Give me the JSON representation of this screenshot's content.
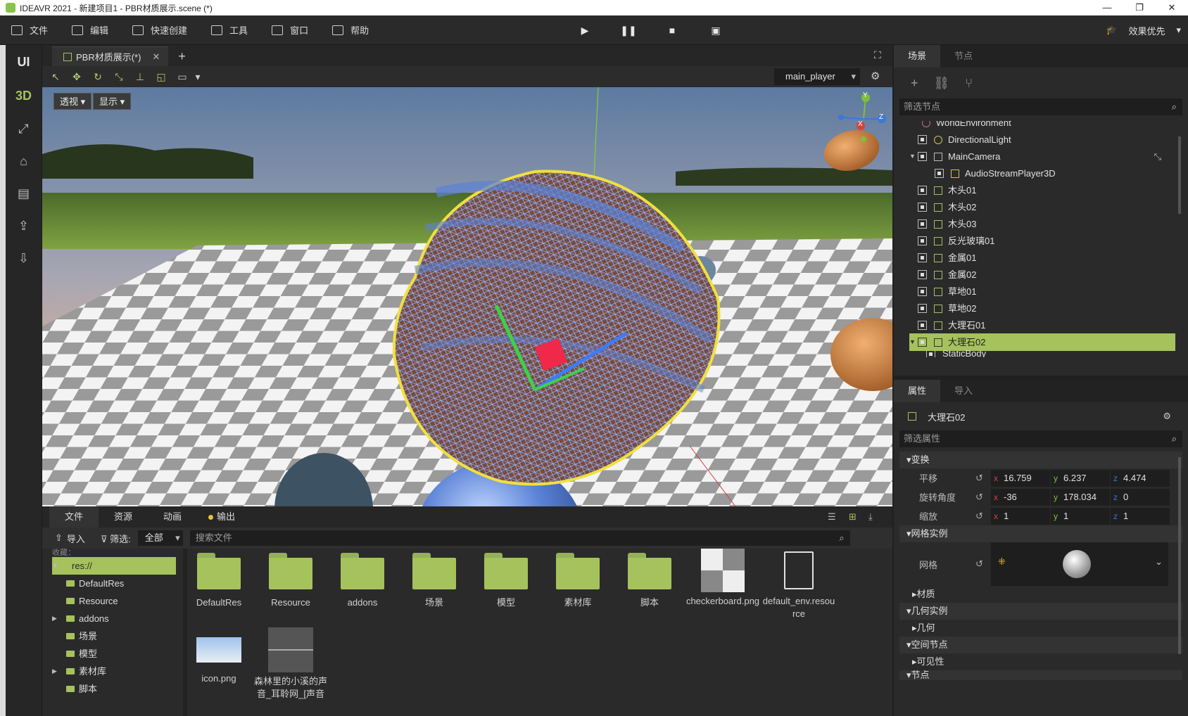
{
  "window": {
    "title": "IDEAVR 2021 - 新建项目1 - PBR材质展示.scene (*)",
    "controls": [
      "—",
      "❐",
      "✕"
    ]
  },
  "menu": {
    "items": [
      "文件",
      "编辑",
      "快速创建",
      "工具",
      "窗口",
      "帮助"
    ],
    "quality": "效果优先"
  },
  "leftbar": {
    "ui": "UI",
    "three_d": "3D"
  },
  "editor": {
    "tab_label": "PBR材质展示(*)",
    "player": "main_player",
    "grid_label": "网格",
    "view_mode": "透视",
    "display_mode": "显示",
    "gizmo_axes": [
      "Y",
      "Z",
      "X"
    ]
  },
  "bottom": {
    "tabs": [
      "文件",
      "资源",
      "动画",
      "输出"
    ],
    "import_label": "导入",
    "filter_label": "筛选:",
    "filter_value": "全部",
    "search_placeholder": "搜索文件",
    "tree_favorites": "收藏：",
    "tree": [
      "res://",
      "DefaultRes",
      "Resource",
      "addons",
      "场景",
      "模型",
      "素材库",
      "脚本"
    ],
    "files_row1": [
      "DefaultRes",
      "Resource",
      "addons",
      "场景",
      "模型",
      "素材库",
      "脚本",
      "checkerboard.png",
      "default_env.resource"
    ],
    "files_row2": [
      "icon.png",
      "森林里的小溪的声音_耳聆网_[声音"
    ]
  },
  "scene": {
    "tabs": [
      "场景",
      "节点"
    ],
    "filter_placeholder": "筛选节点",
    "nodes": [
      "WorldEnvironment",
      "DirectionalLight",
      "MainCamera",
      "AudioStreamPlayer3D",
      "木头01",
      "木头02",
      "木头03",
      "反光玻璃01",
      "金属01",
      "金属02",
      "草地01",
      "草地02",
      "大理石01",
      "大理石02",
      "StaticBody"
    ],
    "selected": "大理石02"
  },
  "props": {
    "tabs": [
      "属性",
      "导入"
    ],
    "node_name": "大理石02",
    "filter_placeholder": "筛选属性",
    "section_transform": "变换",
    "translate_label": "平移",
    "rotate_label": "旋转角度",
    "scale_label": "缩放",
    "translate": {
      "x": "16.759",
      "y": "6.237",
      "z": "4.474"
    },
    "rotate": {
      "x": "-36",
      "y": "178.034",
      "z": "0"
    },
    "scale": {
      "x": "1",
      "y": "1",
      "z": "1"
    },
    "section_mesh": "网格实例",
    "mesh_label": "网格",
    "material_label": "材质",
    "section_geom": "几何实例",
    "geom_label": "几何",
    "section_spatial": "空间节点",
    "visibility_label": "可见性",
    "section_node": "节点"
  },
  "colors": {
    "accent": "#a5c25c",
    "panel": "#2a2a2a",
    "axis_x": "#d0453a",
    "axis_y": "#7fbf3a",
    "axis_z": "#3b78d8"
  }
}
